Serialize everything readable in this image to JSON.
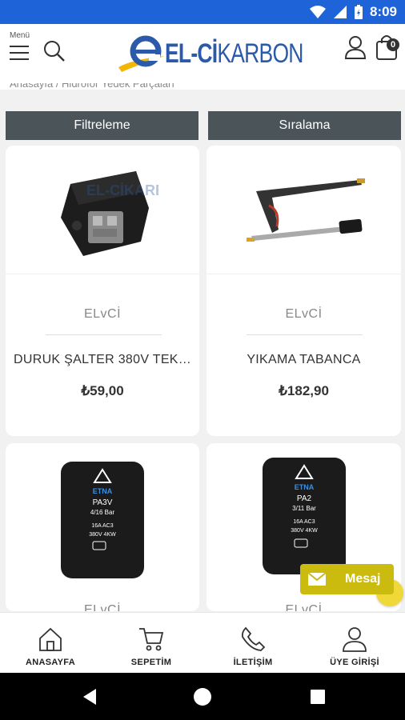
{
  "status_bar": {
    "time": "8:09"
  },
  "header": {
    "menu_label": "Menü",
    "logo_prefix": "EL-Cİ",
    "logo_suffix": "KARBON",
    "cart_count": "0",
    "breadcrumb": "Anasayfa / Hidrofor Yedek Parçaları"
  },
  "toolbar": {
    "filter_label": "Filtreleme",
    "sort_label": "Sıralama"
  },
  "products": [
    {
      "brand": "ELvCİ",
      "title": "DURUK ŞALTER 380V TEK ...",
      "price": "₺59,00"
    },
    {
      "brand": "ELvCİ",
      "title": "YIKAMA TABANCA",
      "price": "₺182,90"
    },
    {
      "brand": "ELvCİ",
      "title": "",
      "price": "",
      "device_brand": "ETNA",
      "device_model": "PA3V",
      "device_range": "4/16 Bar",
      "device_spec1": "16A AC3",
      "device_spec2": "380V 4KW"
    },
    {
      "brand": "ELvCİ",
      "title": "",
      "price": "",
      "device_brand": "ETNA",
      "device_model": "PA2",
      "device_range": "3/11 Bar",
      "device_spec1": "16A AC3",
      "device_spec2": "380V 4KW"
    }
  ],
  "chat": {
    "label": "Mesaj"
  },
  "bottom_nav": [
    {
      "label": "ANASAYFA",
      "icon": "home-icon"
    },
    {
      "label": "SEPETİM",
      "icon": "cart-icon"
    },
    {
      "label": "İLETİŞİM",
      "icon": "phone-icon"
    },
    {
      "label": "ÜYE GİRİŞİ",
      "icon": "user-icon"
    }
  ],
  "colors": {
    "status_bar": "#1e64d8",
    "toolbar_button": "#4a5459",
    "logo_blue": "#2a5aa9",
    "logo_yellow": "#f2b705",
    "chat_button": "#cbbb0e"
  }
}
